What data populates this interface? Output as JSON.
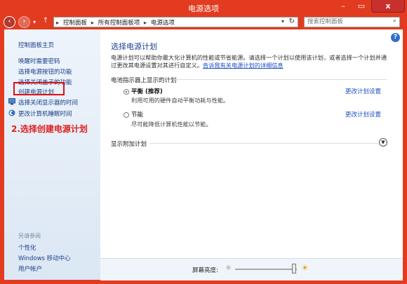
{
  "window": {
    "title": "电源选项",
    "minimize": "–",
    "maximize": "▭",
    "close": "x"
  },
  "nav": {
    "back": "‹",
    "forward": "›",
    "recent": "▾",
    "up": "↑"
  },
  "address": {
    "items": [
      "控制面板",
      "所有控制面板项",
      "电源选项"
    ],
    "separator": "▸",
    "dropdown": "▾",
    "refresh": "↻"
  },
  "search": {
    "placeholder": "搜索控制面板",
    "icon": "search-icon"
  },
  "sidebar": {
    "home": "控制面板主页",
    "links": [
      "唤醒时需要密码",
      "选择电源按钮的功能",
      "选择关闭盖子的功能",
      "创建电源计划",
      "选择关闭显示器的时间",
      "更改计算机睡眠时间"
    ],
    "see_also_title": "另请参阅",
    "see_also": [
      "个性化",
      "Windows 移动中心",
      "用户帐户"
    ]
  },
  "annotation": {
    "text": "2.选择创建电源计划",
    "color": "#e02020"
  },
  "main": {
    "heading": "选择电源计划",
    "description": "电源计划可以帮助你最大化计算机的性能或节省能源。请选择一个计划以使用该计划，或者选择一个计划并通过更改其电源设置对其进行自定义。",
    "description_link": "告诉我有关电源计划的详细信息",
    "battery_section": "电池指示器上显示的计划",
    "plans": [
      {
        "name": "平衡 (推荐)",
        "desc": "利用可用的硬件自动平衡功耗与性能。",
        "link": "更改计划设置",
        "selected": true
      },
      {
        "name": "节能",
        "desc": "尽可能降低计算机性能以节能。",
        "link": "更改计划设置",
        "selected": false
      }
    ],
    "additional": "显示附加计划",
    "expand_icon": "chevron-down-icon"
  },
  "bottom": {
    "brightness_label": "屏幕亮度:",
    "brightness_value": 0.95,
    "dim_icon": "☼",
    "bright_icon": "☀"
  },
  "colors": {
    "accent": "#e23b20",
    "link": "#1c4fc6",
    "heading": "#1b3f94"
  }
}
